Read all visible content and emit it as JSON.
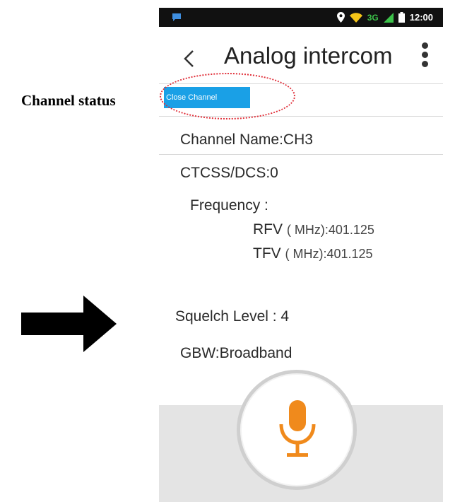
{
  "annotation": {
    "label": "Channel status",
    "arrow_icon": "right-arrow-icon",
    "highlight_color": "#e0303a"
  },
  "status_bar": {
    "network": "3G",
    "time": "12:00",
    "icons": [
      "notification-icon",
      "location-icon",
      "wifi-icon",
      "signal-icon",
      "battery-icon"
    ]
  },
  "app_bar": {
    "title": "Analog intercom",
    "back_icon": "chevron-left-icon",
    "menu_icon": "overflow-menu-icon"
  },
  "channel_control": {
    "button_label": "Close Channel",
    "accent": "#1aa0e6"
  },
  "details": {
    "channel_name": "Channel Name:CH3",
    "ctcss": "CTCSS/DCS:0",
    "frequency_label": "Frequency :",
    "rfv_label": "RFV",
    "rfv_value": "( MHz):401.125",
    "tfv_label": "TFV",
    "tfv_value": "( MHz):401.125",
    "squelch": "Squelch Level : 4",
    "gbw": "GBW:Broadband"
  },
  "talk_button": {
    "icon": "microphone-icon",
    "accent": "#f08a1c"
  }
}
